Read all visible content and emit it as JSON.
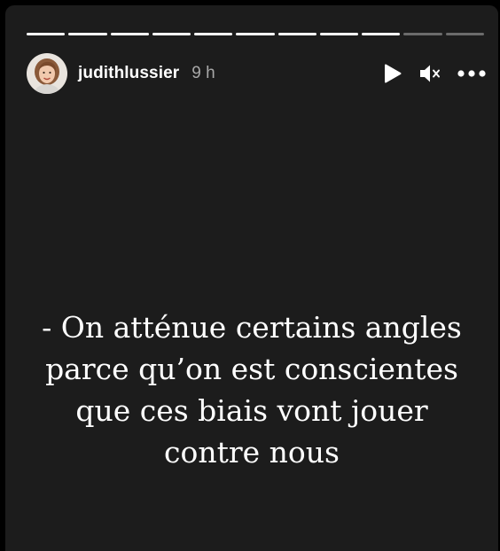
{
  "story": {
    "progress": {
      "total_segments": 11,
      "completed_segments": 9
    },
    "header": {
      "username": "judithlussier",
      "time_ago": "9 h"
    },
    "controls": [
      "play-icon",
      "mute-icon",
      "more-icon"
    ],
    "text_lines": [
      "- On atténue certains angles",
      "parce qu’on est conscientes",
      "que ces biais vont jouer",
      "contre nous"
    ]
  },
  "colors": {
    "background": "#1c1c1c",
    "progress_done": "#ffffff",
    "progress_remaining": "#595959",
    "text": "#ffffff",
    "muted_text": "#a8a8a8"
  }
}
